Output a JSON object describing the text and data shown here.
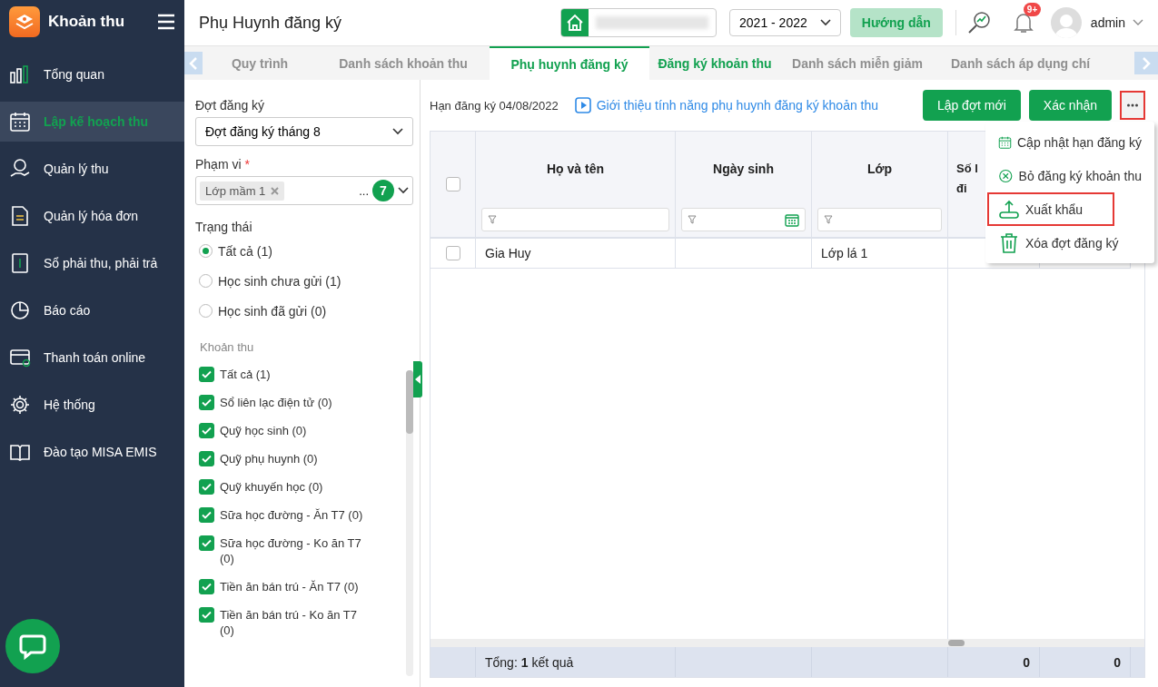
{
  "app": {
    "name": "Khoản thu"
  },
  "sidebar": {
    "items": [
      {
        "label": "Tổng quan",
        "selected": false
      },
      {
        "label": "Lập kế hoạch thu",
        "selected": true
      },
      {
        "label": "Quản lý thu",
        "selected": false
      },
      {
        "label": "Quản lý hóa đơn",
        "selected": false
      },
      {
        "label": "Sổ phải thu, phải trả",
        "selected": false
      },
      {
        "label": "Báo cáo",
        "selected": false
      },
      {
        "label": "Thanh toán online",
        "selected": false
      },
      {
        "label": "Hệ thống",
        "selected": false
      },
      {
        "label": "Đào tạo MISA EMIS",
        "selected": false
      }
    ]
  },
  "header": {
    "title": "Phụ Huynh đăng ký",
    "school_year": "2021 - 2022",
    "guide_button": "Hướng dẫn",
    "notification_badge": "9+",
    "user": "admin"
  },
  "tabs": [
    {
      "label": "Quy trình",
      "selected": false,
      "disabled": true
    },
    {
      "label": "Danh sách khoản thu",
      "selected": false,
      "disabled": true
    },
    {
      "label": "Phụ huynh đăng ký",
      "selected": true,
      "disabled": false
    },
    {
      "label": "Đăng ký khoản thu",
      "selected": false,
      "disabled": false
    },
    {
      "label": "Danh sách miễn giảm",
      "selected": false,
      "disabled": true
    },
    {
      "label": "Danh sách áp dụng chí",
      "selected": false,
      "disabled": true
    }
  ],
  "filters": {
    "period_label": "Đợt đăng ký",
    "period_value": "Đợt đăng ký tháng 8",
    "scope_label": "Phạm vi",
    "required_mark": "*",
    "scope_tag": "Lớp mầm 1",
    "scope_more": "...",
    "scope_count": "7",
    "status_label": "Trạng thái",
    "status_options": [
      {
        "label": "Tất cả (1)",
        "selected": true
      },
      {
        "label": "Học sinh chưa gửi (1)",
        "selected": false
      },
      {
        "label": "Học sinh đã gửi (0)",
        "selected": false
      }
    ],
    "fees_label": "Khoản thu",
    "fees": [
      {
        "label": "Tất cả (1)",
        "checked": true
      },
      {
        "label": "Sổ liên lạc điện tử (0)",
        "checked": true
      },
      {
        "label": "Quỹ học sinh (0)",
        "checked": true
      },
      {
        "label": "Quỹ phụ huynh (0)",
        "checked": true
      },
      {
        "label": "Quỹ khuyến học (0)",
        "checked": true
      },
      {
        "label": "Sữa học đường - Ăn T7 (0)",
        "checked": true
      },
      {
        "label": "Sữa học đường - Ko ăn T7 (0)",
        "checked": true
      },
      {
        "label": "Tiền ăn bán trú - Ăn T7 (0)",
        "checked": true
      },
      {
        "label": "Tiền ăn bán trú - Ko ăn T7 (0)",
        "checked": true
      }
    ]
  },
  "toolbar": {
    "deadline": "Hạn đăng ký 04/08/2022",
    "intro_link": "Giới thiệu tính năng phụ huynh đăng ký khoản thu",
    "buttons": [
      "Lập đợt mới",
      "Xác nhận"
    ],
    "more_highlighted": true
  },
  "more_menu": {
    "items": [
      {
        "label": "Cập nhật hạn đăng ký",
        "highlighted": false
      },
      {
        "label": "Bỏ đăng ký khoản thu",
        "highlighted": false
      },
      {
        "label": "Xuất khẩu",
        "highlighted": true
      },
      {
        "label": "Xóa đợt đăng ký",
        "highlighted": false
      }
    ]
  },
  "table": {
    "select_all": {
      "checked": false
    },
    "columns": [
      {
        "label": "Họ và tên"
      },
      {
        "label": "Ngày sinh"
      },
      {
        "label": "Lớp"
      },
      {
        "label": "Số l\nđi"
      }
    ],
    "rows": [
      {
        "selected": false,
        "name": "Gia Huy",
        "class": "Lớp lá 1"
      }
    ],
    "footer": {
      "summary": "Tổng: **1** kết quả",
      "totals": [
        "0",
        "0"
      ]
    }
  }
}
